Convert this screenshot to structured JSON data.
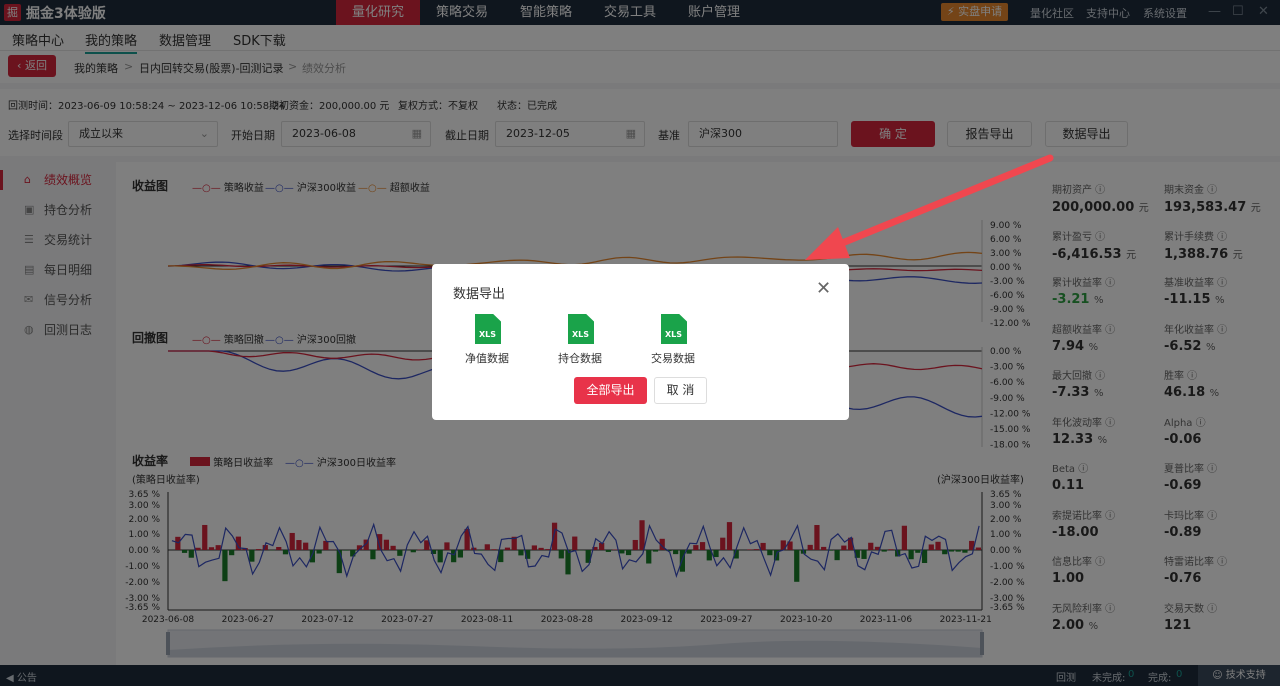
{
  "app": {
    "name": "掘金3体验版",
    "logo": "掘",
    "live_button": "实盘申请",
    "top_links": [
      "量化社区",
      "支持中心",
      "系统设置"
    ],
    "menu": [
      "量化研究",
      "策略交易",
      "智能策略",
      "交易工具",
      "账户管理"
    ],
    "active_menu": "量化研究"
  },
  "subnav": {
    "items": [
      "策略中心",
      "我的策略",
      "数据管理",
      "SDK下载"
    ],
    "active": "我的策略"
  },
  "breadcrumb": {
    "back": "返回",
    "items": [
      "我的策略",
      ">",
      "日内回转交易(股票)-回测记录",
      ">",
      "绩效分析"
    ]
  },
  "backtest_info": {
    "time": "回测时间：2023-06-09 10:58:24 ~ 2023-12-06 10:58:24",
    "capital": "期初资金：200,000.00 元",
    "adjust": "复权方式：不复权",
    "status": "状态：已完成"
  },
  "filters": {
    "period_label": "选择时间段",
    "period_value": "成立以来",
    "start_label": "开始日期",
    "start_value": "2023-06-08",
    "end_label": "截止日期",
    "end_value": "2023-12-05",
    "bench_label": "基准",
    "bench_value": "沪深300"
  },
  "buttons": {
    "confirm": "确 定",
    "report_export": "报告导出",
    "data_export": "数据导出"
  },
  "sidebar": [
    {
      "icon": "home-icon",
      "label": "绩效概览"
    },
    {
      "icon": "position-icon",
      "label": "持仓分析"
    },
    {
      "icon": "stats-icon",
      "label": "交易统计"
    },
    {
      "icon": "calendar-icon",
      "label": "每日明细"
    },
    {
      "icon": "signal-icon",
      "label": "信号分析"
    },
    {
      "icon": "log-icon",
      "label": "回测日志"
    }
  ],
  "charts": {
    "returns": {
      "title": "收益图",
      "legend": [
        "策略收益",
        "沪深300收益",
        "超额收益"
      ],
      "axis": [
        "9.00 %",
        "6.00 %",
        "3.00 %",
        "0.00 %",
        "-3.00 %",
        "-6.00 %",
        "-9.00 %",
        "-12.00 %"
      ]
    },
    "drawdown": {
      "title": "回撤图",
      "legend": [
        "策略回撤",
        "沪深300回撤"
      ],
      "axis": [
        "0.00 %",
        "-3.00 %",
        "-6.00 %",
        "-9.00 %",
        "-12.00 %",
        "-15.00 %",
        "-18.00 %"
      ]
    },
    "daily": {
      "title": "收益率",
      "legend": [
        "策略日收益率",
        "沪深300日收益率"
      ],
      "left_sub": "(策略日收益率)",
      "right_sub": "(沪深300日收益率)",
      "axis": [
        "3.65 %",
        "3.00 %",
        "2.00 %",
        "1.00 %",
        "0.00 %",
        "-1.00 %",
        "-2.00 %",
        "-3.00 %",
        "-3.65 %"
      ],
      "dates": [
        "2023-06-08",
        "2023-06-27",
        "2023-07-12",
        "2023-07-27",
        "2023-08-11",
        "2023-08-28",
        "2023-09-12",
        "2023-09-27",
        "2023-10-20",
        "2023-11-06",
        "2023-11-21"
      ]
    }
  },
  "colors": {
    "strategy": "#d7263d",
    "benchmark": "#3b4fc4",
    "excess": "#e8892e",
    "bar_pos": "#d7263d",
    "bar_neg": "#1a7f2a"
  },
  "metrics": [
    {
      "label": "期初资产",
      "value": "200,000.00",
      "unit": "元"
    },
    {
      "label": "期末资金",
      "value": "193,583.47",
      "unit": "元"
    },
    {
      "label": "累计盈亏",
      "value": "-6,416.53",
      "unit": "元"
    },
    {
      "label": "累计手续费",
      "value": "1,388.76",
      "unit": "元"
    },
    {
      "label": "累计收益率",
      "value": "-3.21",
      "unit": "%"
    },
    {
      "label": "基准收益率",
      "value": "-11.15",
      "unit": "%"
    },
    {
      "label": "超额收益率",
      "value": "7.94",
      "unit": "%"
    },
    {
      "label": "年化收益率",
      "value": "-6.52",
      "unit": "%"
    },
    {
      "label": "最大回撤",
      "value": "-7.33",
      "unit": "%"
    },
    {
      "label": "胜率",
      "value": "46.18",
      "unit": "%"
    },
    {
      "label": "年化波动率",
      "value": "12.33",
      "unit": "%"
    },
    {
      "label": "Alpha",
      "value": "-0.06",
      "unit": ""
    },
    {
      "label": "Beta",
      "value": "0.11",
      "unit": ""
    },
    {
      "label": "夏普比率",
      "value": "-0.69",
      "unit": ""
    },
    {
      "label": "索提诺比率",
      "value": "-18.00",
      "unit": ""
    },
    {
      "label": "卡玛比率",
      "value": "-0.89",
      "unit": ""
    },
    {
      "label": "信息比率",
      "value": "1.00",
      "unit": ""
    },
    {
      "label": "特雷诺比率",
      "value": "-0.76",
      "unit": ""
    },
    {
      "label": "无风险利率",
      "value": "2.00",
      "unit": "%"
    },
    {
      "label": "交易天数",
      "value": "121",
      "unit": ""
    }
  ],
  "modal": {
    "title": "数据导出",
    "files": [
      {
        "ext": "XLS",
        "label": "净值数据"
      },
      {
        "ext": "XLS",
        "label": "持仓数据"
      },
      {
        "ext": "XLS",
        "label": "交易数据"
      }
    ],
    "export_all": "全部导出",
    "cancel": "取 消"
  },
  "statusbar": {
    "announce": "公告",
    "backtest": "回测",
    "pending": "未完成:",
    "pending_n": "0",
    "done": "完成:",
    "done_n": "0",
    "support": "技术支持"
  }
}
